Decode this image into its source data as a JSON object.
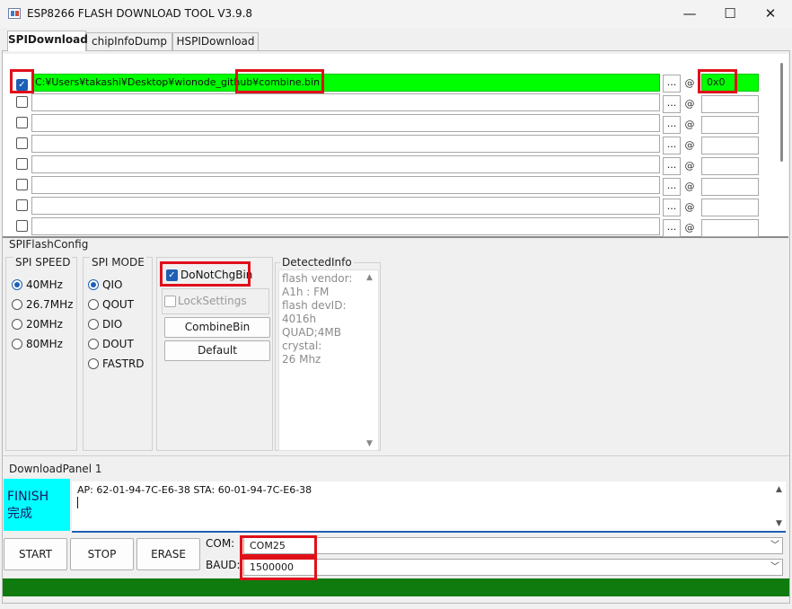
{
  "window": {
    "title": "ESP8266 FLASH DOWNLOAD TOOL V3.9.8",
    "minimize": "—",
    "maximize": "☐",
    "close": "✕"
  },
  "tabs": [
    {
      "label": "SPIDownload",
      "active": true
    },
    {
      "label": "chipInfoDump",
      "active": false
    },
    {
      "label": "HSPIDownload",
      "active": false
    }
  ],
  "file_rows": [
    {
      "checked": true,
      "path": "C:¥Users¥takashi¥Desktop¥wionode_github¥combine.bin",
      "browse": "...",
      "at": "@",
      "address": "0x0"
    },
    {
      "checked": false,
      "path": "",
      "browse": "...",
      "at": "@",
      "address": ""
    },
    {
      "checked": false,
      "path": "",
      "browse": "...",
      "at": "@",
      "address": ""
    },
    {
      "checked": false,
      "path": "",
      "browse": "...",
      "at": "@",
      "address": ""
    },
    {
      "checked": false,
      "path": "",
      "browse": "...",
      "at": "@",
      "address": ""
    },
    {
      "checked": false,
      "path": "",
      "browse": "...",
      "at": "@",
      "address": ""
    },
    {
      "checked": false,
      "path": "",
      "browse": "...",
      "at": "@",
      "address": ""
    },
    {
      "checked": false,
      "path": "",
      "browse": "...",
      "at": "@",
      "address": ""
    }
  ],
  "spi_flash_config": {
    "label": "SPIFlashConfig",
    "spi_speed": {
      "label": "SPI SPEED",
      "options": [
        "40MHz",
        "26.7MHz",
        "20MHz",
        "80MHz"
      ],
      "selected": "40MHz"
    },
    "spi_mode": {
      "label": "SPI MODE",
      "options": [
        "QIO",
        "QOUT",
        "DIO",
        "DOUT",
        "FASTRD"
      ],
      "selected": "QIO"
    },
    "do_not_chg_bin": {
      "label": "DoNotChgBin",
      "checked": true
    },
    "lock_settings": {
      "label": "LockSettings",
      "checked": false,
      "disabled": true
    },
    "combine_bin_label": "CombineBin",
    "default_label": "Default",
    "detected_info": {
      "label": "DetectedInfo",
      "lines": [
        "flash vendor:",
        "A1h : FM",
        "flash devID:",
        "4016h",
        "QUAD;4MB",
        "crystal:",
        "26 Mhz"
      ]
    }
  },
  "download_panel": {
    "label": "DownloadPanel 1",
    "status_en": "FINISH",
    "status_jp": "完成",
    "status_color": "#00ffff",
    "log": "AP:  62-01-94-7C-E6-38  STA:  60-01-94-7C-E6-38",
    "buttons": {
      "start": "START",
      "stop": "STOP",
      "erase": "ERASE"
    },
    "com_label": "COM:",
    "com_value": "COM25",
    "baud_label": "BAUD:",
    "baud_value": "1500000",
    "progress": 1.0,
    "progress_color": "#0f7b0f"
  },
  "colors": {
    "highlight_green": "#00ff00",
    "annotation_red": "#e0101a",
    "accent_blue": "#1d5fb4"
  }
}
